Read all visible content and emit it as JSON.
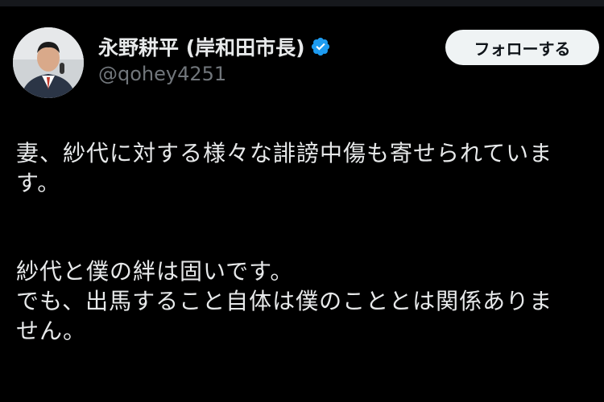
{
  "author": {
    "display_name": "永野耕平 (岸和田市長)",
    "handle": "@qohey4251",
    "verified_icon": "verified-badge-icon",
    "verified_color": "#1d9bf0"
  },
  "follow_button": {
    "label": "フォローする"
  },
  "post": {
    "paragraph1": [
      "妻、紗代に対する様々な誹謗中傷も寄せられていま",
      "す。"
    ],
    "paragraph2": [
      "紗代と僕の絆は固いです。",
      "でも、出馬すること自体は僕のこととは関係ありま",
      "せん。"
    ]
  },
  "colors": {
    "background": "#000000",
    "text_primary": "#e7e9ea",
    "text_secondary": "#71767b",
    "button_bg": "#eff3f4",
    "button_text": "#0f1419"
  }
}
